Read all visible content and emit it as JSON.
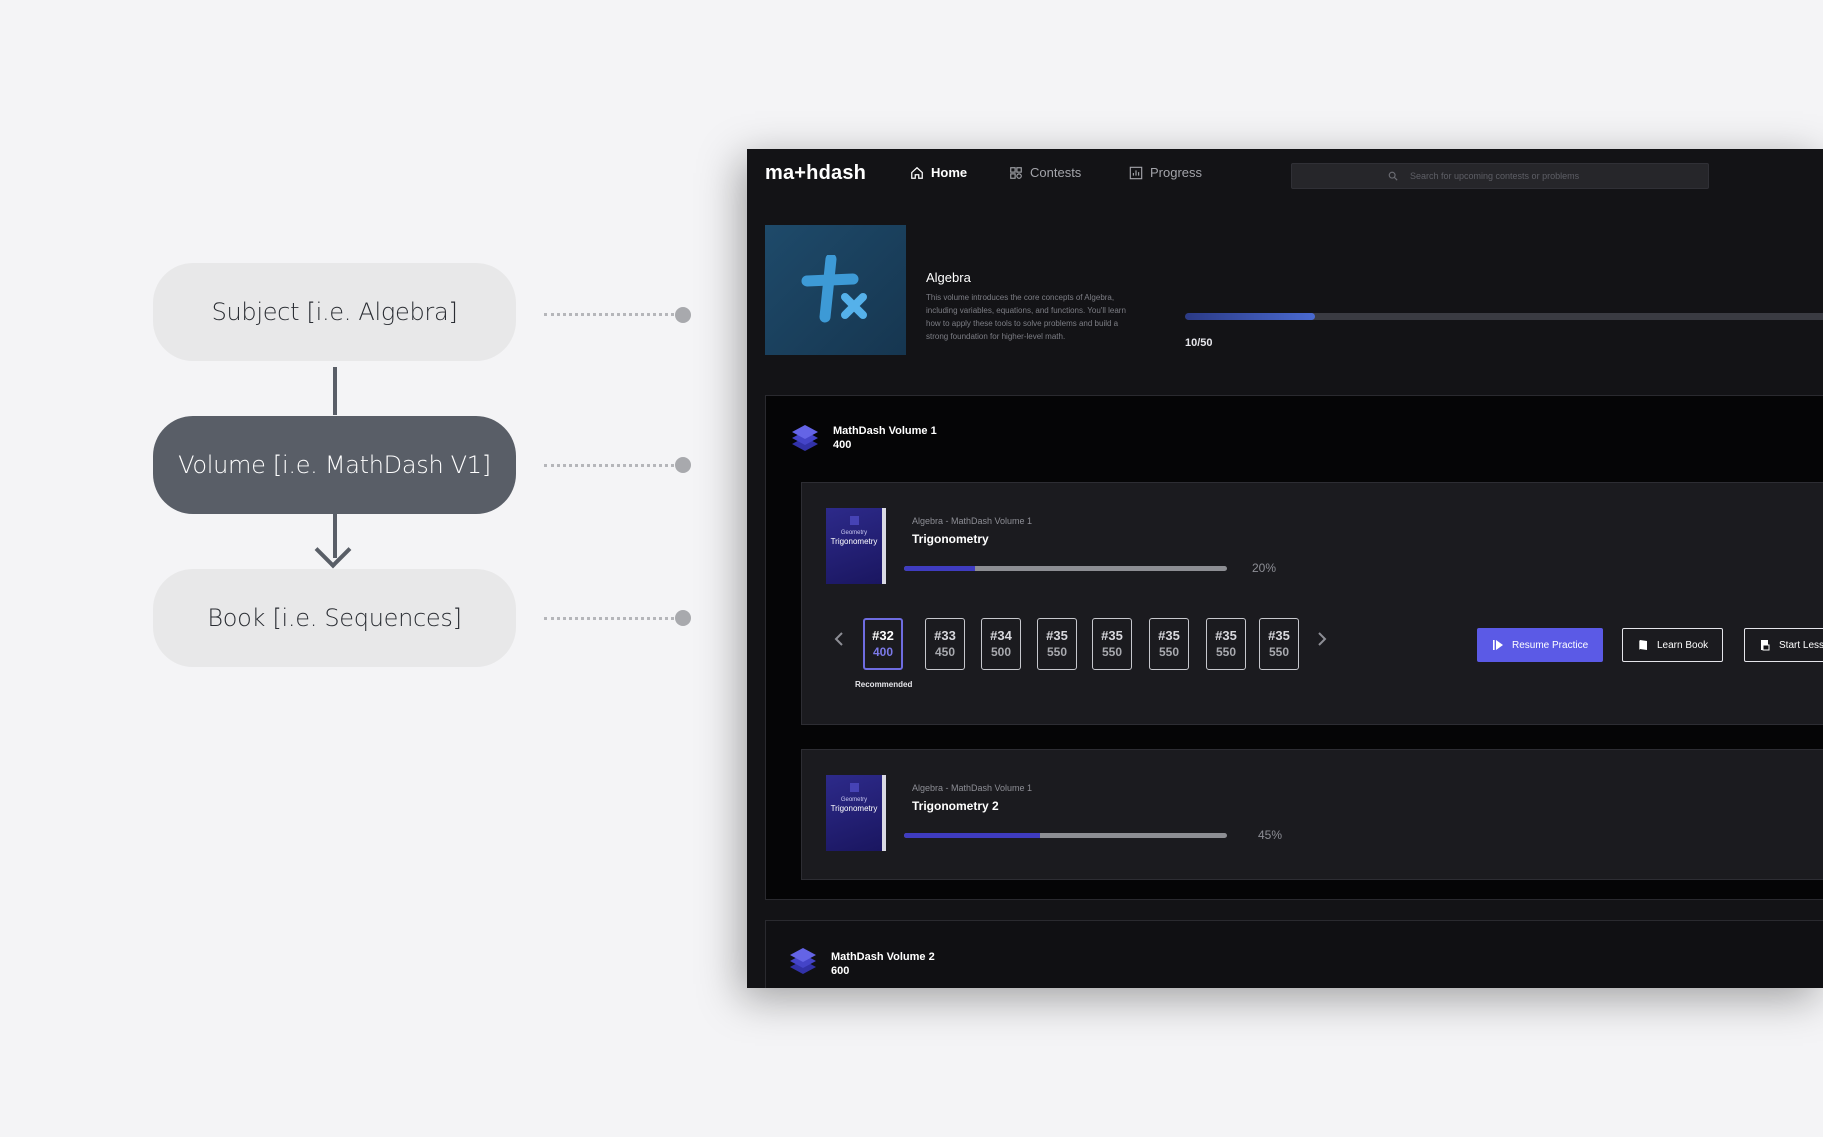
{
  "diagram": {
    "subject": "Subject [i.e. Algebra]",
    "volume": "Volume [i.e. MathDash V1]",
    "book": "Book [i.e. Sequences]"
  },
  "app": {
    "logo": "ma+hdash",
    "nav": [
      {
        "label": "Home",
        "icon": "home-icon",
        "active": true
      },
      {
        "label": "Contests",
        "icon": "contests-icon",
        "active": false
      },
      {
        "label": "Progress",
        "icon": "progress-chart-icon",
        "active": false
      }
    ],
    "search": {
      "placeholder": "Search for upcoming contests or problems",
      "icon": "search-icon"
    },
    "subject": {
      "title": "Algebra",
      "description": "This volume introduces the core concepts of Algebra, including variables, equations, and functions. You'll learn how to apply these tools to solve problems and build a strong foundation for higher-level math.",
      "progress_text": "10/50",
      "progress_fraction": 0.2,
      "icon": "plus-times-icon"
    },
    "volumes": [
      {
        "name": "MathDash Volume 1",
        "count": "400",
        "icon": "layers-icon",
        "books": [
          {
            "cover_small": "Geometry",
            "cover_big": "Trigonometry",
            "subtitle": "Algebra - MathDash Volume 1",
            "title": "Trigonometry",
            "progress_text": "20%",
            "progress_fraction": 0.22,
            "chips": [
              {
                "num": "#32",
                "pts": "400",
                "recommended": true
              },
              {
                "num": "#33",
                "pts": "450",
                "recommended": false
              },
              {
                "num": "#34",
                "pts": "500",
                "recommended": false
              },
              {
                "num": "#35",
                "pts": "550",
                "recommended": false
              },
              {
                "num": "#35",
                "pts": "550",
                "recommended": false
              },
              {
                "num": "#35",
                "pts": "550",
                "recommended": false
              },
              {
                "num": "#35",
                "pts": "550",
                "recommended": false
              },
              {
                "num": "#35",
                "pts": "550",
                "recommended": false
              }
            ],
            "recommended_label": "Recommended",
            "buttons": {
              "resume": "Resume Practice",
              "learn": "Learn Book",
              "start": "Start Less"
            }
          },
          {
            "cover_small": "Geometry",
            "cover_big": "Trigonometry",
            "subtitle": "Algebra - MathDash Volume 1",
            "title": "Trigonometry 2",
            "progress_text": "45%",
            "progress_fraction": 0.42
          }
        ]
      },
      {
        "name": "MathDash Volume 2",
        "count": "600",
        "icon": "layers-icon"
      }
    ]
  },
  "colors": {
    "accent": "#5b5ae6",
    "app_bg": "#131316",
    "diagram_dark": "#595e67",
    "diagram_light": "#e8e8e9"
  }
}
